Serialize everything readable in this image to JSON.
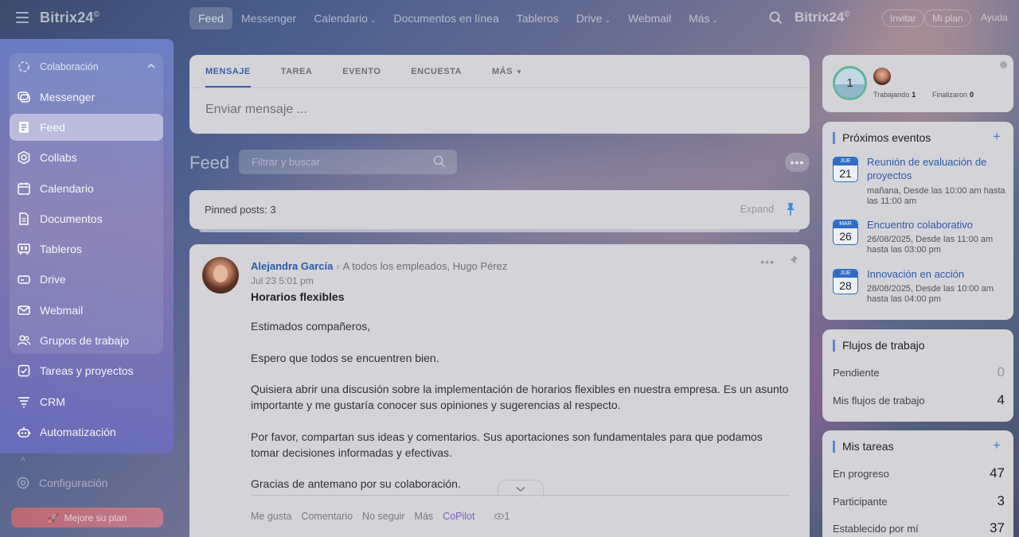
{
  "app": {
    "logo": "Bitrix24",
    "logo_mark": "©"
  },
  "topnav": {
    "items": [
      {
        "label": "Feed",
        "active": true
      },
      {
        "label": "Messenger"
      },
      {
        "label": "Calendario",
        "caret": true
      },
      {
        "label": "Documentos en línea"
      },
      {
        "label": "Tableros"
      },
      {
        "label": "Drive",
        "caret": true
      },
      {
        "label": "Webmail"
      },
      {
        "label": "Más",
        "caret": true
      }
    ],
    "brand": "Bitrix24",
    "invite": "Invitar",
    "plan": "Mi plan",
    "help": "Ayuda"
  },
  "sidebar": {
    "group_header": "Colaboración",
    "items": [
      {
        "label": "Messenger",
        "icon": "chat-icon"
      },
      {
        "label": "Feed",
        "icon": "feed-icon",
        "active": true
      },
      {
        "label": "Collabs",
        "icon": "hexagon-icon"
      },
      {
        "label": "Calendario",
        "icon": "calendar-icon"
      },
      {
        "label": "Documentos",
        "icon": "document-icon"
      },
      {
        "label": "Tableros",
        "icon": "board-icon"
      },
      {
        "label": "Drive",
        "icon": "drive-icon"
      },
      {
        "label": "Webmail",
        "icon": "mail-icon"
      },
      {
        "label": "Grupos de trabajo",
        "icon": "group-icon"
      },
      {
        "label": "Tareas y proyectos",
        "icon": "checkbox-icon"
      },
      {
        "label": "CRM",
        "icon": "crm-icon"
      },
      {
        "label": "Automatización",
        "icon": "robot-icon"
      }
    ],
    "settings": "Configuración",
    "upgrade": "Mejore su plan"
  },
  "compose": {
    "tabs": [
      "MENSAJE",
      "TAREA",
      "EVENTO",
      "ENCUESTA",
      "MÁS"
    ],
    "placeholder": "Enviar mensaje ..."
  },
  "feed": {
    "title": "Feed",
    "search_placeholder": "Filtrar y buscar",
    "more": "•••"
  },
  "pinned": {
    "text": "Pinned posts: 3",
    "expand": "Expand"
  },
  "post": {
    "author": "Alejandra García",
    "recipients": "A todos los empleados, Hugo Pérez",
    "date": "Jul 23 5:01 pm",
    "title": "Horarios flexibles",
    "paragraphs": [
      "Estimados compañeros,",
      "Espero que todos se encuentren bien.",
      "Quisiera abrir una discusión sobre la implementación de horarios flexibles en nuestra empresa. Es un asunto importante y me gustaría conocer sus opiniones y sugerencias al respecto.",
      "Por favor, compartan sus ideas y comentarios. Sus aportaciones son fundamentales para que podamos tomar decisiones informadas y efectivas.",
      "Gracias de antemano por su colaboración."
    ],
    "actions": {
      "like": "Me gusta",
      "comment": "Comentario",
      "unfollow": "No seguir",
      "more": "Más",
      "copilot": "CoPilot",
      "views": "1"
    }
  },
  "status": {
    "count": "1",
    "working_label": "Trabajando",
    "working": "1",
    "finished_label": "Finalizaron",
    "finished": "0"
  },
  "events": {
    "title": "Próximos eventos",
    "items": [
      {
        "month": "JUE",
        "day": "21",
        "title": "Reunión de evaluación de proyectos",
        "meta": "mañana, Desde las 10:00 am hasta las 11:00 am"
      },
      {
        "month": "MAR",
        "day": "26",
        "title": "Encuentro colaborativo",
        "meta": "26/08/2025, Desde las 11:00 am hasta las 03:00 pm"
      },
      {
        "month": "JUE",
        "day": "28",
        "title": "Innovación en acción",
        "meta": "28/08/2025, Desde las 10:00 am hasta las 04:00 pm"
      }
    ]
  },
  "workflows": {
    "title": "Flujos de trabajo",
    "rows": [
      {
        "label": "Pendiente",
        "value": "0"
      },
      {
        "label": "Mis flujos de trabajo",
        "value": "4"
      }
    ]
  },
  "tasks": {
    "title": "Mis tareas",
    "rows": [
      {
        "label": "En progreso",
        "value": "47"
      },
      {
        "label": "Participante",
        "value": "3"
      },
      {
        "label": "Establecido por mí",
        "value": "37"
      }
    ]
  },
  "colors": {
    "accent": "#2f6dc8",
    "link": "#2c5aa8",
    "copilot": "#7d5fc7",
    "upgrade": "#c27b8d"
  }
}
